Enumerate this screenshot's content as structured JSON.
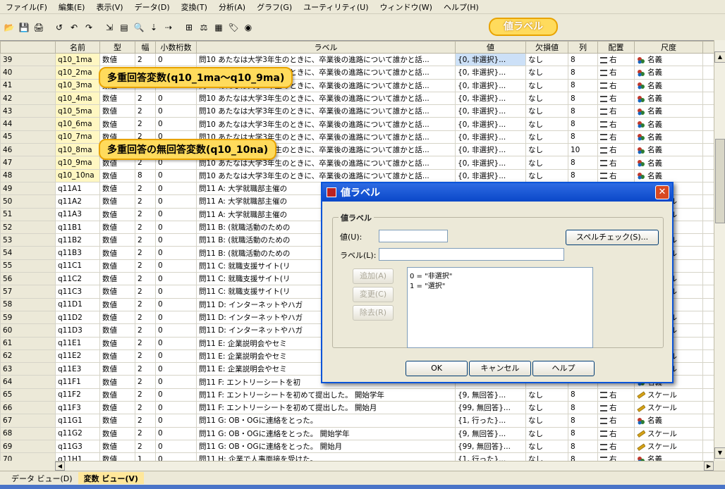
{
  "menu": [
    "ファイル(F)",
    "編集(E)",
    "表示(V)",
    "データ(D)",
    "変換(T)",
    "分析(A)",
    "グラフ(G)",
    "ユーティリティ(U)",
    "ウィンドウ(W)",
    "ヘルプ(H)"
  ],
  "toolbar_icons": [
    "open-icon",
    "save-icon",
    "print-icon",
    "dialog-recall-icon",
    "undo-icon",
    "redo-icon",
    "goto-case-icon",
    "variables-icon",
    "find-icon",
    "insert-cases-icon",
    "insert-variable-icon",
    "split-file-icon",
    "weight-cases-icon",
    "select-cases-icon",
    "value-labels-icon",
    "use-sets-icon"
  ],
  "headers": [
    "",
    "名前",
    "型",
    "幅",
    "小数桁数",
    "ラベル",
    "値",
    "欠損値",
    "列",
    "配置",
    "尺度",
    ""
  ],
  "rows": [
    [
      "39",
      "q10_1ma",
      "数値",
      "2",
      "0",
      "問10 あたなは大学3年生のときに、卒業後の進路について誰かと話...",
      "{0, 非選択}...",
      "なし",
      "8",
      "右",
      "名義"
    ],
    [
      "40",
      "q10_2ma",
      "数値",
      "2",
      "0",
      "問10 あたなは大学3年生のときに、卒業後の進路について誰かと話...",
      "{0, 非選択}...",
      "なし",
      "8",
      "右",
      "名義"
    ],
    [
      "41",
      "q10_3ma",
      "数値",
      "2",
      "0",
      "問10 あたなは大学3年生のときに、卒業後の進路について誰かと話...",
      "{0, 非選択}...",
      "なし",
      "8",
      "右",
      "名義"
    ],
    [
      "42",
      "q10_4ma",
      "数値",
      "2",
      "0",
      "問10 あたなは大学3年生のときに、卒業後の進路について誰かと話...",
      "{0, 非選択}...",
      "なし",
      "8",
      "右",
      "名義"
    ],
    [
      "43",
      "q10_5ma",
      "数値",
      "2",
      "0",
      "問10 あたなは大学3年生のときに、卒業後の進路について誰かと話...",
      "{0, 非選択}...",
      "なし",
      "8",
      "右",
      "名義"
    ],
    [
      "44",
      "q10_6ma",
      "数値",
      "2",
      "0",
      "問10 あたなは大学3年生のときに、卒業後の進路について誰かと話...",
      "{0, 非選択}...",
      "なし",
      "8",
      "右",
      "名義"
    ],
    [
      "45",
      "q10_7ma",
      "数値",
      "2",
      "0",
      "問10 あたなは大学3年生のときに、卒業後の進路について誰かと話...",
      "{0, 非選択}...",
      "なし",
      "8",
      "右",
      "名義"
    ],
    [
      "46",
      "q10_8ma",
      "数値",
      "2",
      "0",
      "問10 あたなは大学3年生のときに、卒業後の進路について誰かと話...",
      "{0, 非選択}...",
      "なし",
      "10",
      "右",
      "名義"
    ],
    [
      "47",
      "q10_9ma",
      "数値",
      "2",
      "0",
      "問10 あたなは大学3年生のときに、卒業後の進路について誰かと話...",
      "{0, 非選択}...",
      "なし",
      "8",
      "右",
      "名義"
    ],
    [
      "48",
      "q10_10na",
      "数値",
      "8",
      "0",
      "問10 あたなは大学3年生のときに、卒業後の進路について誰かと話...",
      "{0, 非選択}...",
      "なし",
      "8",
      "右",
      "名義"
    ],
    [
      "49",
      "q11A1",
      "数値",
      "2",
      "0",
      "問11 A: 大学就職部主催の",
      "",
      "",
      "",
      "",
      "名義"
    ],
    [
      "50",
      "q11A2",
      "数値",
      "2",
      "0",
      "問11 A: 大学就職部主催の",
      "",
      "",
      "",
      "",
      "スケール"
    ],
    [
      "51",
      "q11A3",
      "数値",
      "2",
      "0",
      "問11 A: 大学就職部主催の",
      "",
      "",
      "",
      "",
      "スケール"
    ],
    [
      "52",
      "q11B1",
      "数値",
      "2",
      "0",
      "問11 B: (就職活動のための",
      "",
      "",
      "",
      "",
      "名義"
    ],
    [
      "53",
      "q11B2",
      "数値",
      "2",
      "0",
      "問11 B: (就職活動のための",
      "",
      "",
      "",
      "",
      "スケール"
    ],
    [
      "54",
      "q11B3",
      "数値",
      "2",
      "0",
      "問11 B: (就職活動のための",
      "",
      "",
      "",
      "",
      "スケール"
    ],
    [
      "55",
      "q11C1",
      "数値",
      "2",
      "0",
      "問11 C: 就職支援サイト(リ",
      "",
      "",
      "",
      "",
      "名義"
    ],
    [
      "56",
      "q11C2",
      "数値",
      "2",
      "0",
      "問11 C: 就職支援サイト(リ",
      "",
      "",
      "",
      "",
      "スケール"
    ],
    [
      "57",
      "q11C3",
      "数値",
      "2",
      "0",
      "問11 C: 就職支援サイト(リ",
      "",
      "",
      "",
      "",
      "スケール"
    ],
    [
      "58",
      "q11D1",
      "数値",
      "2",
      "0",
      "問11 D: インターネットやハガ",
      "",
      "",
      "",
      "",
      "名義"
    ],
    [
      "59",
      "q11D2",
      "数値",
      "2",
      "0",
      "問11 D: インターネットやハガ",
      "",
      "",
      "",
      "",
      "スケール"
    ],
    [
      "60",
      "q11D3",
      "数値",
      "2",
      "0",
      "問11 D: インターネットやハガ",
      "",
      "",
      "",
      "",
      "スケール"
    ],
    [
      "61",
      "q11E1",
      "数値",
      "2",
      "0",
      "問11 E: 企業説明会やセミ",
      "",
      "",
      "",
      "",
      "名義"
    ],
    [
      "62",
      "q11E2",
      "数値",
      "2",
      "0",
      "問11 E: 企業説明会やセミ",
      "",
      "",
      "",
      "",
      "スケール"
    ],
    [
      "63",
      "q11E3",
      "数値",
      "2",
      "0",
      "問11 E: 企業説明会やセミ",
      "",
      "",
      "",
      "",
      "スケール"
    ],
    [
      "64",
      "q11F1",
      "数値",
      "2",
      "0",
      "問11 F: エントリーシートを初",
      "",
      "",
      "",
      "",
      "名義"
    ],
    [
      "65",
      "q11F2",
      "数値",
      "2",
      "0",
      "問11 F: エントリーシートを初めて提出した。 開始学年",
      "{9, 無回答}...",
      "なし",
      "8",
      "右",
      "スケール"
    ],
    [
      "66",
      "q11F3",
      "数値",
      "2",
      "0",
      "問11 F: エントリーシートを初めて提出した。 開始月",
      "{99, 無回答}...",
      "なし",
      "8",
      "右",
      "スケール"
    ],
    [
      "67",
      "q11G1",
      "数値",
      "2",
      "0",
      "問11 G: OB・OGに連絡をとった。",
      "{1, 行った}...",
      "なし",
      "8",
      "右",
      "名義"
    ],
    [
      "68",
      "q11G2",
      "数値",
      "2",
      "0",
      "問11 G: OB・OGに連絡をとった。 開始学年",
      "{9, 無回答}...",
      "なし",
      "8",
      "右",
      "スケール"
    ],
    [
      "69",
      "q11G3",
      "数値",
      "2",
      "0",
      "問11 G: OB・OGに連絡をとった。 開始月",
      "{99, 無回答}...",
      "なし",
      "8",
      "右",
      "スケール"
    ],
    [
      "70",
      "q11H1",
      "数値",
      "1",
      "0",
      "問11 H: 企業で人事面接を受けた。",
      "{1, 行った}...",
      "なし",
      "8",
      "右",
      "名義"
    ]
  ],
  "align_label": "右",
  "callouts": {
    "title": "値ラベル",
    "multi": "多重回答変数(q10_1ma〜q10_9ma)",
    "noans": "多重回答の無回答変数(q10_10na)"
  },
  "dialog": {
    "title": "値ラベル",
    "group": "値ラベル",
    "value_label": "値(U):",
    "label_label": "ラベル(L):",
    "spell": "スペルチェック(S)...",
    "add": "追加(A)",
    "change": "変更(C)",
    "remove": "除去(R)",
    "list": [
      "0 = \"非選択\"",
      "1 = \"選択\""
    ],
    "ok": "OK",
    "cancel": "キャンセル",
    "help": "ヘルプ"
  },
  "tabs": [
    "データ ビュー(D)",
    "変数 ビュー(V)"
  ],
  "colors": {
    "callout": "#ffdb5c",
    "dialog_title": "#0a47c9",
    "nominal_icon": "#c0392b",
    "scale_icon": "#d4a017"
  }
}
